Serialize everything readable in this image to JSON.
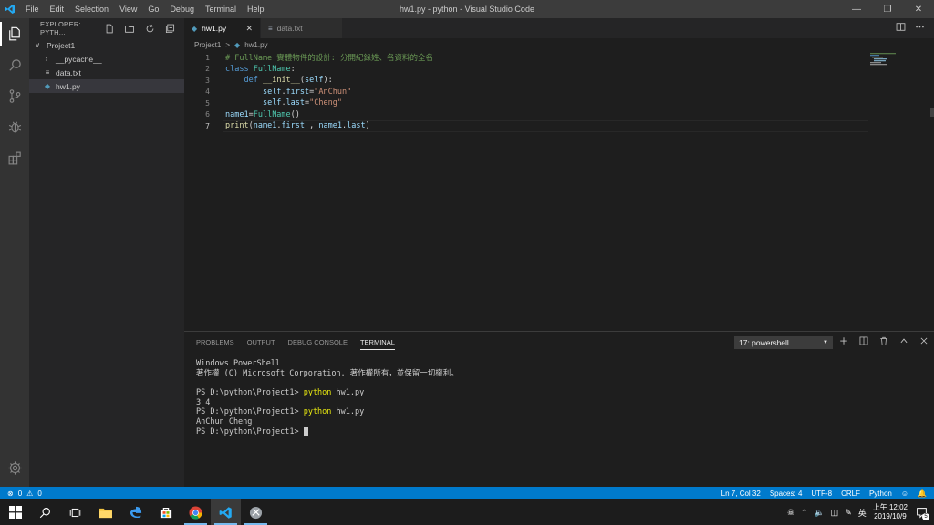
{
  "window": {
    "title": "hw1.py - python - Visual Studio Code",
    "menu": [
      "File",
      "Edit",
      "Selection",
      "View",
      "Go",
      "Debug",
      "Terminal",
      "Help"
    ]
  },
  "sidebar": {
    "header": "EXPLORER: PYTH...",
    "tree": [
      {
        "label": "Project1",
        "type": "folder-open",
        "indent": 0
      },
      {
        "label": "__pycache__",
        "type": "folder",
        "indent": 1
      },
      {
        "label": "data.txt",
        "type": "text-file",
        "indent": 1
      },
      {
        "label": "hw1.py",
        "type": "python-file",
        "indent": 1,
        "selected": true
      }
    ]
  },
  "tabs": [
    {
      "label": "hw1.py",
      "active": true,
      "icon": "python-file-icon"
    },
    {
      "label": "data.txt",
      "active": false,
      "icon": "text-file-icon"
    }
  ],
  "breadcrumb": {
    "folder": "Project1",
    "separator": ">",
    "file": "hw1.py"
  },
  "editor": {
    "current_line": 7,
    "lines": [
      {
        "n": "1",
        "indent": "",
        "tokens": [
          {
            "t": "# FullName 實體物件的設計: 分開紀錄姓、名資料的全名",
            "c": "com"
          }
        ]
      },
      {
        "n": "2",
        "indent": "",
        "tokens": [
          {
            "t": "class ",
            "c": "kw"
          },
          {
            "t": "FullName",
            "c": "cls"
          },
          {
            "t": ":",
            "c": "plain"
          }
        ]
      },
      {
        "n": "3",
        "indent": "    ",
        "tokens": [
          {
            "t": "def ",
            "c": "kw"
          },
          {
            "t": "__init__",
            "c": "fn"
          },
          {
            "t": "(",
            "c": "plain"
          },
          {
            "t": "self",
            "c": "var"
          },
          {
            "t": "):",
            "c": "plain"
          }
        ]
      },
      {
        "n": "4",
        "indent": "        ",
        "tokens": [
          {
            "t": "self",
            "c": "var"
          },
          {
            "t": ".",
            "c": "plain"
          },
          {
            "t": "first",
            "c": "var"
          },
          {
            "t": "=",
            "c": "plain"
          },
          {
            "t": "\"AnChun\"",
            "c": "str"
          }
        ]
      },
      {
        "n": "5",
        "indent": "        ",
        "tokens": [
          {
            "t": "self",
            "c": "var"
          },
          {
            "t": ".",
            "c": "plain"
          },
          {
            "t": "last",
            "c": "var"
          },
          {
            "t": "=",
            "c": "plain"
          },
          {
            "t": "\"Cheng\"",
            "c": "str"
          }
        ]
      },
      {
        "n": "6",
        "indent": "",
        "tokens": [
          {
            "t": "name1",
            "c": "var"
          },
          {
            "t": "=",
            "c": "plain"
          },
          {
            "t": "FullName",
            "c": "cls"
          },
          {
            "t": "()",
            "c": "plain"
          }
        ]
      },
      {
        "n": "7",
        "indent": "",
        "tokens": [
          {
            "t": "print",
            "c": "fn"
          },
          {
            "t": "(",
            "c": "plain"
          },
          {
            "t": "name1",
            "c": "var"
          },
          {
            "t": ".",
            "c": "plain"
          },
          {
            "t": "first",
            "c": "var"
          },
          {
            "t": " , ",
            "c": "plain"
          },
          {
            "t": "name1",
            "c": "var"
          },
          {
            "t": ".",
            "c": "plain"
          },
          {
            "t": "last",
            "c": "var"
          },
          {
            "t": ")",
            "c": "plain"
          }
        ]
      }
    ]
  },
  "panel": {
    "tabs": [
      {
        "label": "PROBLEMS",
        "active": false
      },
      {
        "label": "OUTPUT",
        "active": false
      },
      {
        "label": "DEBUG CONSOLE",
        "active": false
      },
      {
        "label": "TERMINAL",
        "active": true
      }
    ],
    "terminal_select": "17: powershell",
    "terminal_lines": [
      {
        "text": "Windows PowerShell"
      },
      {
        "text": "著作權 (C) Microsoft Corporation. 著作權所有，並保留一切權利。"
      },
      {
        "text": ""
      },
      {
        "prompt": "PS D:\\python\\Project1> ",
        "cmd": "python",
        "args": " hw1.py"
      },
      {
        "text": "3 4"
      },
      {
        "prompt": "PS D:\\python\\Project1> ",
        "cmd": "python",
        "args": " hw1.py"
      },
      {
        "text": "AnChun Cheng"
      },
      {
        "prompt": "PS D:\\python\\Project1> ",
        "cursor": true
      }
    ]
  },
  "statusbar": {
    "errors": "0",
    "warnings": "0",
    "position": "Ln 7, Col 32",
    "spaces": "Spaces: 4",
    "encoding": "UTF-8",
    "eol": "CRLF",
    "language": "Python"
  },
  "taskbar": {
    "ime": "英",
    "time": "上午 12:02",
    "date": "2019/10/9",
    "notification_count": "5"
  },
  "colors": {
    "accent": "#007acc",
    "title_bar": "#3c3c3c",
    "activity_bar": "#333333",
    "sidebar": "#252526",
    "editor": "#1e1e1e"
  }
}
